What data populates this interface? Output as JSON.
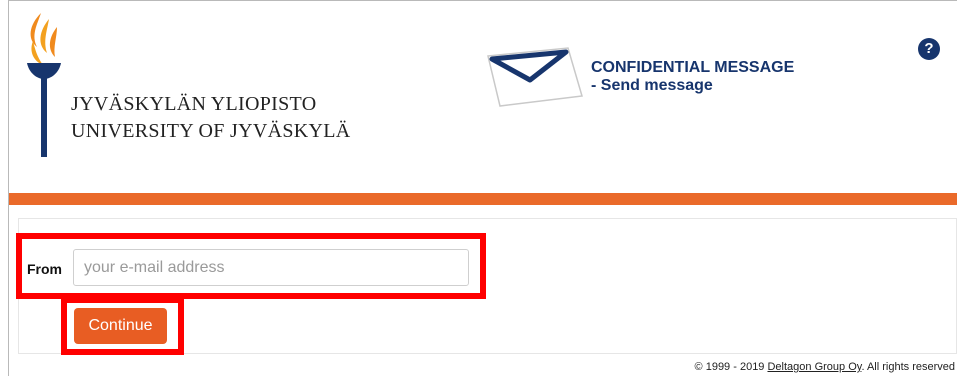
{
  "header": {
    "university_line1": "JYVÄSKYLÄN YLIOPISTO",
    "university_line2": "UNIVERSITY OF JYVÄSKYLÄ",
    "title_line1": "CONFIDENTIAL MESSAGE",
    "title_line2": "- Send message",
    "help_icon": "question-mark-icon",
    "help_label": "?"
  },
  "form": {
    "from_label": "From",
    "email_placeholder": "your e-mail address",
    "email_value": "",
    "continue_label": "Continue"
  },
  "footer": {
    "copyright_prefix": "© 1999 - 2019 ",
    "company_link": "Deltagon Group Oy",
    "copyright_suffix": ". All rights reserved"
  },
  "colors": {
    "brand_navy": "#17356d",
    "accent_orange": "#ea6a2a",
    "button_orange": "#e85d23",
    "highlight_red": "#ff0000"
  }
}
